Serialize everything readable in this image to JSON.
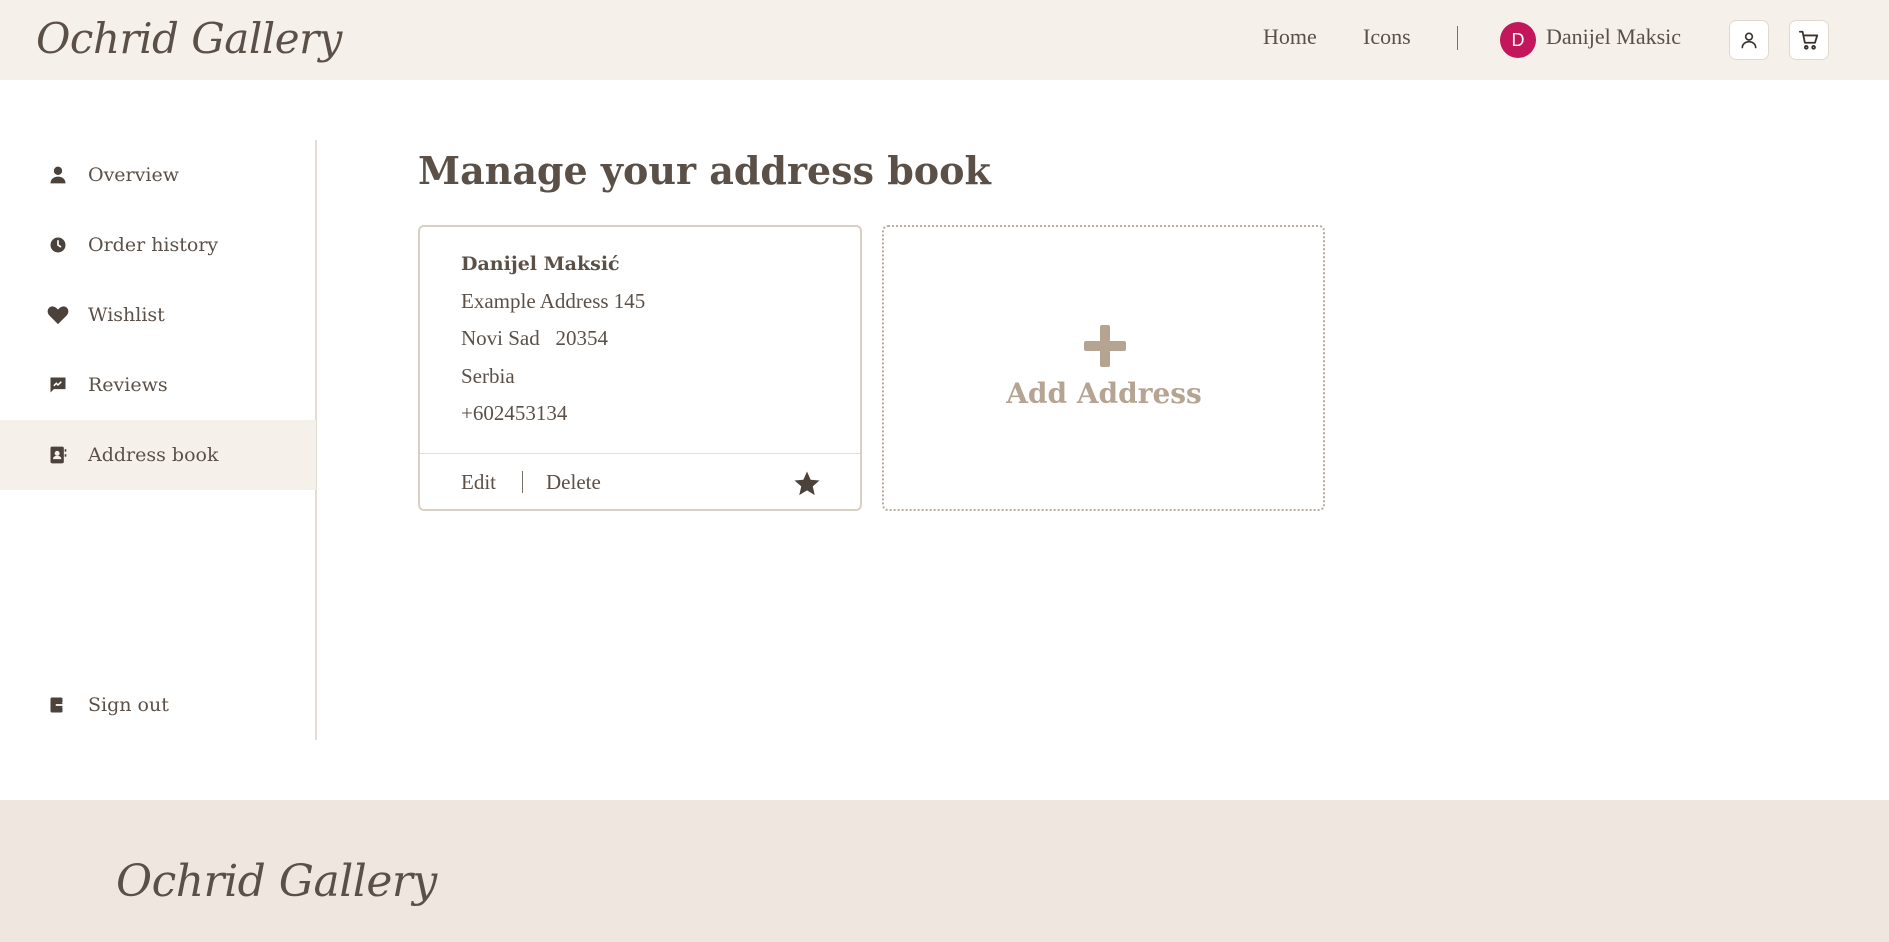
{
  "header": {
    "logo": "Ochrid Gallery",
    "nav": {
      "home": "Home",
      "icons": "Icons"
    },
    "user": {
      "avatar_initial": "D",
      "name": "Danijel Maksic",
      "avatar_color": "#c2185b"
    },
    "account_icon": "user-icon",
    "cart_icon": "cart-icon"
  },
  "sidebar": {
    "items": [
      {
        "label": "Overview",
        "icon": "person-icon"
      },
      {
        "label": "Order history",
        "icon": "history-icon"
      },
      {
        "label": "Wishlist",
        "icon": "heart-icon"
      },
      {
        "label": "Reviews",
        "icon": "review-icon"
      },
      {
        "label": "Address book",
        "icon": "address-book-icon",
        "active": true
      }
    ],
    "sign_out": {
      "label": "Sign out",
      "icon": "sign-out-icon"
    }
  },
  "main": {
    "title": "Manage your address book",
    "address": {
      "name": "Danijel Maksić",
      "street": "Example Address 145",
      "city_zip": "Novi Sad   20354",
      "country": "Serbia",
      "phone": "+602453134",
      "edit_label": "Edit",
      "delete_label": "Delete",
      "default_icon": "star-icon"
    },
    "add_address": {
      "label": "Add Address",
      "icon": "plus-icon"
    }
  },
  "footer": {
    "logo": "Ochrid Gallery"
  },
  "colors": {
    "header_bg": "#f5f0ea",
    "footer_bg": "#efe7df",
    "text": "#5a5048",
    "accent_muted": "#b5a491"
  }
}
